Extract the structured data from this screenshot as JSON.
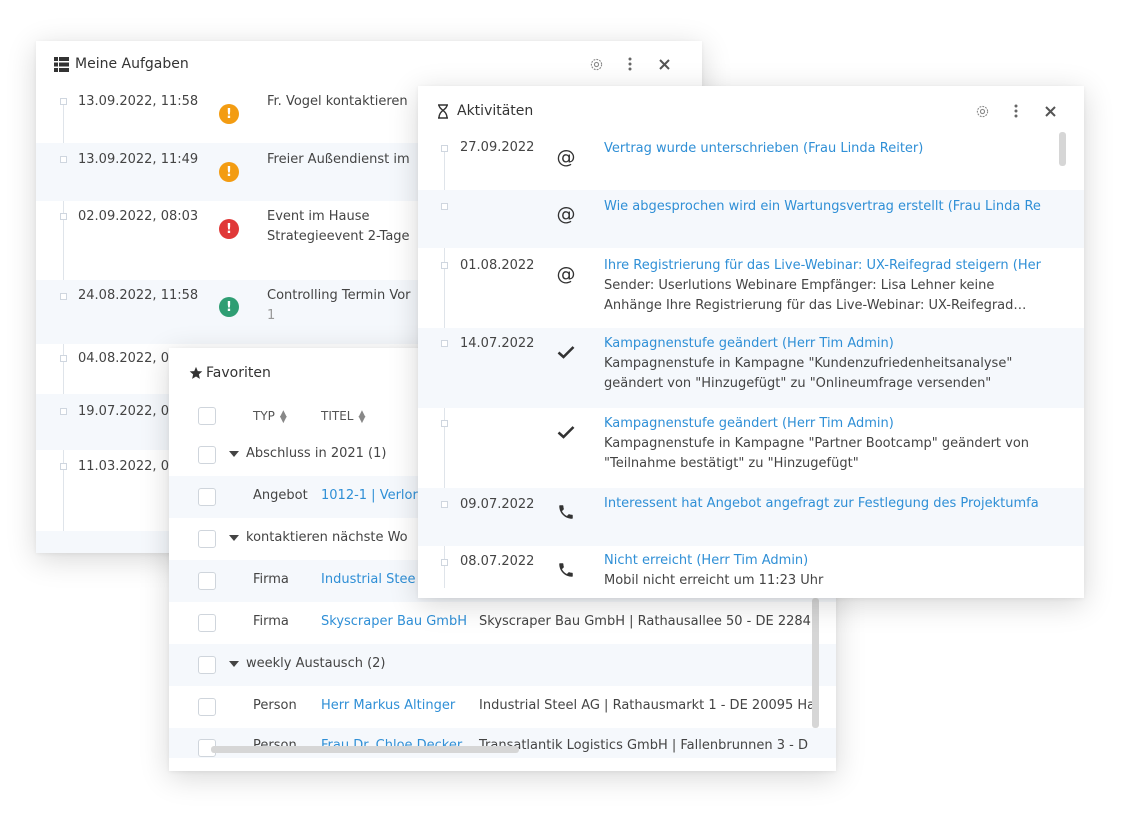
{
  "tasks": {
    "title": "Meine Aufgaben",
    "items": [
      {
        "date": "13.09.2022, 11:58",
        "priority": "orange",
        "line1": "Fr. Vogel kontaktieren",
        "line2": ""
      },
      {
        "date": "13.09.2022, 11:49",
        "priority": "orange",
        "line1": "Freier Außendienst im",
        "line2": ""
      },
      {
        "date": "02.09.2022, 08:03",
        "priority": "red",
        "line1": "Event im Hause",
        "line2": "Strategieevent 2-Tage"
      },
      {
        "date": "24.08.2022, 11:58",
        "priority": "green",
        "line1": "Controlling Termin Vor",
        "line2": "1"
      },
      {
        "date": "04.08.2022, 04",
        "priority": "",
        "line1": "",
        "line2": ""
      },
      {
        "date": "19.07.2022, 03:",
        "priority": "",
        "line1": "",
        "line2": ""
      },
      {
        "date": "11.03.2022, 07:",
        "priority": "",
        "line1": "",
        "line2": ""
      }
    ]
  },
  "activities": {
    "title": "Aktivitäten",
    "items": [
      {
        "date": "27.09.2022",
        "icon": "at-icon",
        "title": "Vertrag wurde unterschrieben (Frau Linda Reiter)",
        "body": []
      },
      {
        "date": "",
        "icon": "at-icon",
        "title": "Wie abgesprochen wird ein Wartungsvertrag erstellt (Frau Linda Re",
        "body": []
      },
      {
        "date": "01.08.2022",
        "icon": "at-icon",
        "title": "Ihre Registrierung für das Live-Webinar: UX-Reifegrad steigern (Her",
        "body": [
          "Sender: Userlutions Webinare Empfänger: Lisa Lehner keine",
          "Anhänge Ihre Registrierung für das Live-Webinar: UX-Reifegrad…"
        ]
      },
      {
        "date": "14.07.2022",
        "icon": "check-icon",
        "title": "Kampagnenstufe geändert (Herr Tim Admin)",
        "body": [
          "Kampagnenstufe in Kampagne \"Kundenzufriedenheitsanalyse\"",
          "geändert von \"Hinzugefügt\" zu \"Onlineumfrage versenden\""
        ]
      },
      {
        "date": "",
        "icon": "check-icon",
        "title": "Kampagnenstufe geändert (Herr Tim Admin)",
        "body": [
          "Kampagnenstufe in Kampagne \"Partner Bootcamp\" geändert von",
          "\"Teilnahme bestätigt\" zu \"Hinzugefügt\""
        ]
      },
      {
        "date": "09.07.2022",
        "icon": "phone-icon",
        "title": "Interessent hat Angebot angefragt zur Festlegung des Projektumfa",
        "body": []
      },
      {
        "date": "08.07.2022",
        "icon": "phone-icon",
        "title": "Nicht erreicht (Herr Tim Admin)",
        "body": [
          "Mobil nicht erreicht um 11:23 Uhr"
        ]
      }
    ]
  },
  "favorites": {
    "title": "Favoriten",
    "columns": {
      "type": "TYP",
      "title": "TITEL"
    },
    "groups": [
      {
        "label": "Abschluss in 2021 (1)",
        "rows": [
          {
            "type": "Angebot",
            "title": "1012-1 | Verlore",
            "detail": ""
          }
        ]
      },
      {
        "label": "kontaktieren nächste Wo",
        "rows": [
          {
            "type": "Firma",
            "title": "Industrial Stee",
            "detail": ""
          },
          {
            "type": "Firma",
            "title": "Skyscraper Bau GmbH",
            "detail": "Skyscraper Bau GmbH | Rathausallee 50 - DE 2284("
          }
        ]
      },
      {
        "label": "weekly Austausch (2)",
        "rows": [
          {
            "type": "Person",
            "title": "Herr Markus Altinger",
            "detail": "Industrial Steel AG | Rathausmarkt 1 - DE 20095 Ha"
          },
          {
            "type": "Person",
            "title": "Frau Dr. Chloe Decker",
            "detail": "Transatlantik Logistics GmbH | Fallenbrunnen 3 - D"
          }
        ]
      }
    ]
  }
}
